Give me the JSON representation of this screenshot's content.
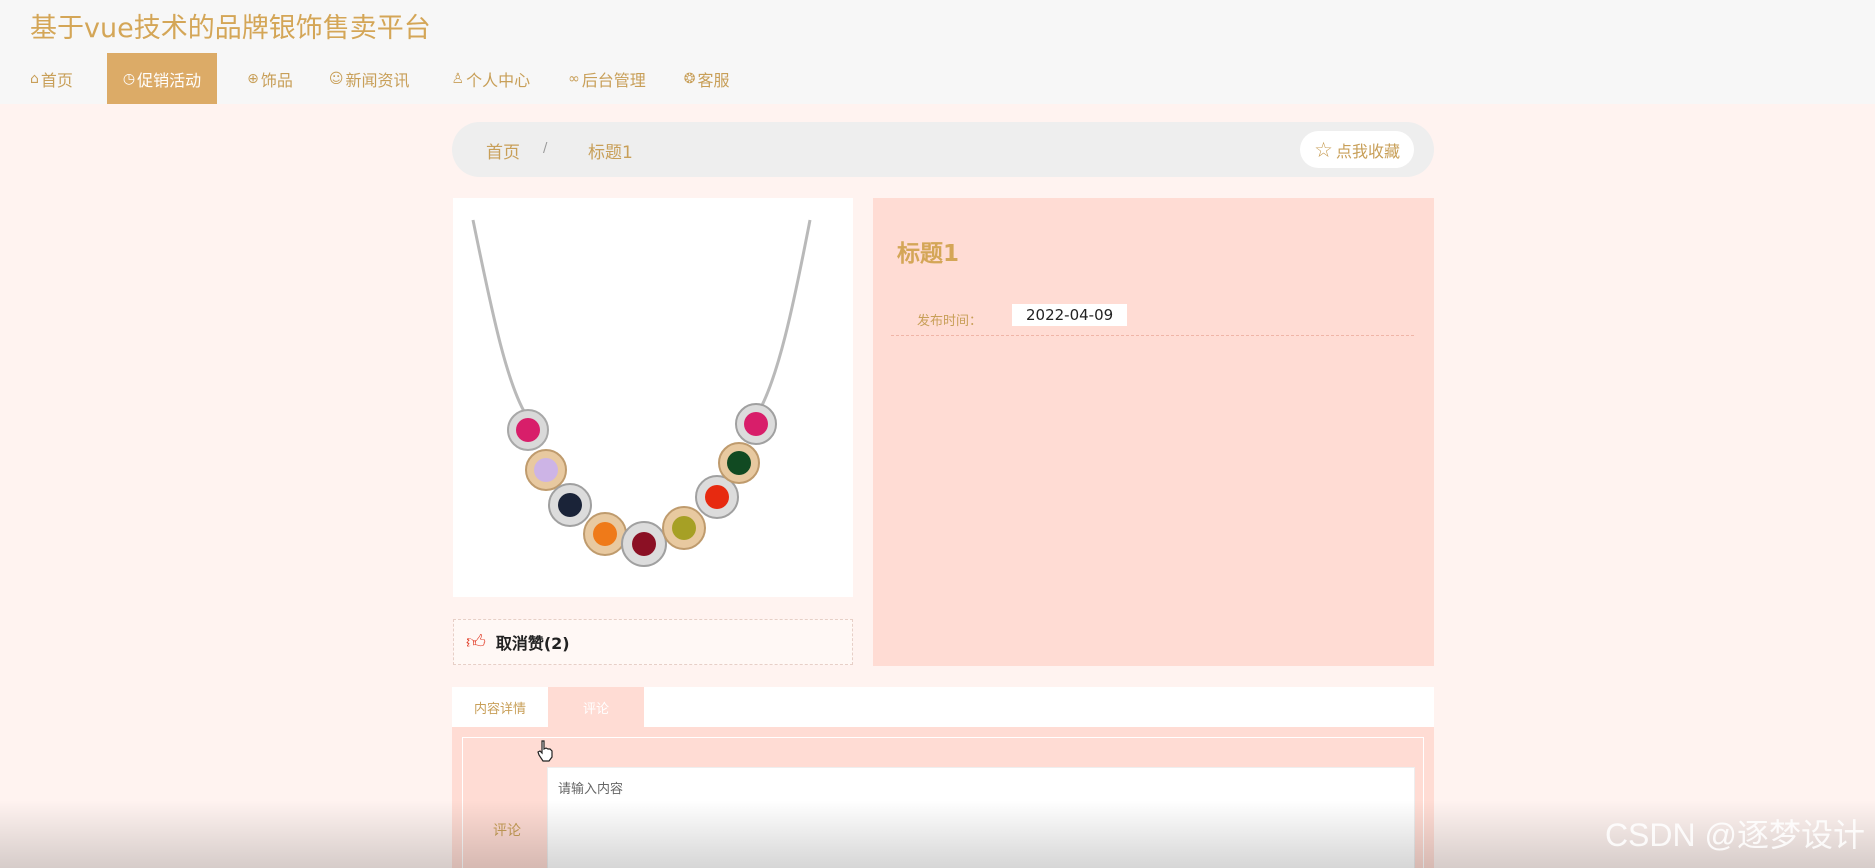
{
  "site": {
    "title": "基于vue技术的品牌银饰售卖平台"
  },
  "nav": {
    "items": [
      {
        "label": "首页",
        "icon": "home-icon"
      },
      {
        "label": "促销活动",
        "icon": "clock-icon",
        "active": true
      },
      {
        "label": "饰品",
        "icon": "globe-icon"
      },
      {
        "label": "新闻资讯",
        "icon": "smile-icon"
      },
      {
        "label": "个人中心",
        "icon": "user-icon"
      },
      {
        "label": "后台管理",
        "icon": "link-icon"
      },
      {
        "label": "客服",
        "icon": "chat-icon"
      }
    ]
  },
  "breadcrumb": {
    "home": "首页",
    "separator": "/",
    "current": "标题1"
  },
  "favorite": {
    "label": "点我收藏"
  },
  "product": {
    "title": "标题1",
    "date_label": "发布时间：",
    "date_value": "2022-04-09"
  },
  "like": {
    "label": "取消赞(2)"
  },
  "tabs": [
    {
      "label": "内容详情"
    },
    {
      "label": "评论",
      "active": true
    }
  ],
  "comment": {
    "label": "评论",
    "placeholder": "请输入内容"
  },
  "watermark": "CSDN @逐梦设计",
  "colors": {
    "accent": "#dcab67",
    "text_gold": "#c89f58",
    "panel_pink": "#ffdcd4",
    "background": "#fff3f0",
    "like_red": "#e2442f"
  }
}
